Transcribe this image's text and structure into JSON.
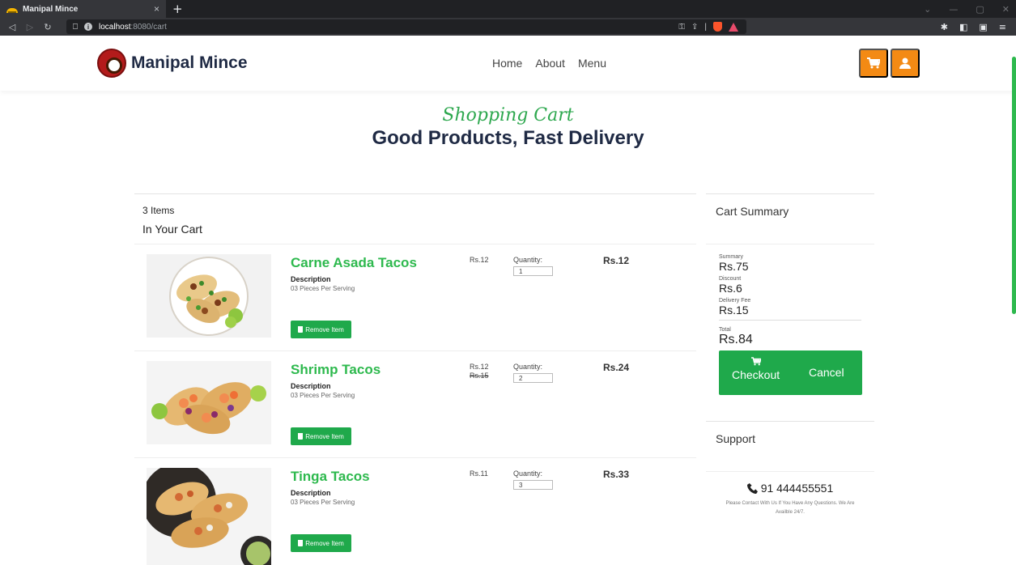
{
  "browser": {
    "tab_title": "Manipal Mince",
    "tab_close": "×",
    "new_tab": "+",
    "url_host": "localhost",
    "url_path": ":8080/cart"
  },
  "site": {
    "brand": "Manipal Mince",
    "nav": [
      "Home",
      "About",
      "Menu"
    ]
  },
  "hero": {
    "script": "Shopping Cart",
    "title": "Good Products, Fast Delivery"
  },
  "cart": {
    "count_text": "3 Items",
    "in_cart": "In Your Cart",
    "desc_label": "Description",
    "qty_label": "Quantity:",
    "remove_label": "Remove Item",
    "items": [
      {
        "name": "Carne Asada Tacos",
        "desc": "03 Pieces Per Serving",
        "price": "Rs.12",
        "old_price": "",
        "qty": "1",
        "total": "Rs.12"
      },
      {
        "name": "Shrimp Tacos",
        "desc": "03 Pieces Per Serving",
        "price": "Rs.12",
        "old_price": "Rs.15",
        "qty": "2",
        "total": "Rs.24"
      },
      {
        "name": "Tinga Tacos",
        "desc": "03 Pieces Per Serving",
        "price": "Rs.11",
        "old_price": "",
        "qty": "3",
        "total": "Rs.33"
      }
    ]
  },
  "summary": {
    "title": "Cart Summary",
    "summary_label": "Summary",
    "summary_value": "Rs.75",
    "discount_label": "Discount",
    "discount_value": "Rs.6",
    "delivery_label": "Delivery Fee",
    "delivery_value": "Rs.15",
    "total_label": "Total",
    "total_value": "Rs.84",
    "checkout_label": "Checkout",
    "cancel_label": "Cancel"
  },
  "support": {
    "title": "Support",
    "phone": "91 444455551",
    "text": "Please Contact With Us If You Have Any Questions. We Are Availble 24/7."
  },
  "colors": {
    "accent_green": "#1fa94b",
    "accent_orange": "#f38a14",
    "title_navy": "#1f2a44"
  }
}
